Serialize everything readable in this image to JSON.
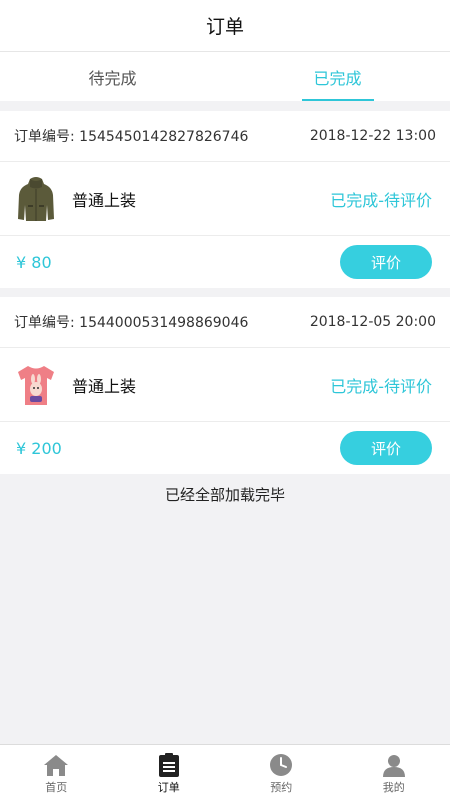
{
  "header": {
    "title": "订单"
  },
  "tabs": [
    {
      "label": "待完成",
      "active": false
    },
    {
      "label": "已完成",
      "active": true
    }
  ],
  "orders": [
    {
      "number_label": "订单编号: 1545450142827826746",
      "date": "2018-12-22 13:00",
      "item_name": "普通上装",
      "status": "已完成-待评价",
      "price": "¥ 80",
      "button": "评价",
      "thumb_icon": "green-jacket-image"
    },
    {
      "number_label": "订单编号: 1544000531498869046",
      "date": "2018-12-05 20:00",
      "item_name": "普通上装",
      "status": "已完成-待评价",
      "price": "¥ 200",
      "button": "评价",
      "thumb_icon": "pink-tshirt-image"
    }
  ],
  "footer_text": "已经全部加载完毕",
  "tabbar": [
    {
      "label": "首页",
      "icon": "home-icon"
    },
    {
      "label": "订单",
      "icon": "clipboard-icon"
    },
    {
      "label": "预约",
      "icon": "clock-icon"
    },
    {
      "label": "我的",
      "icon": "user-icon"
    }
  ],
  "colors": {
    "accent": "#2ec6d8",
    "button": "#36cfdf",
    "background": "#f2f2f4"
  }
}
